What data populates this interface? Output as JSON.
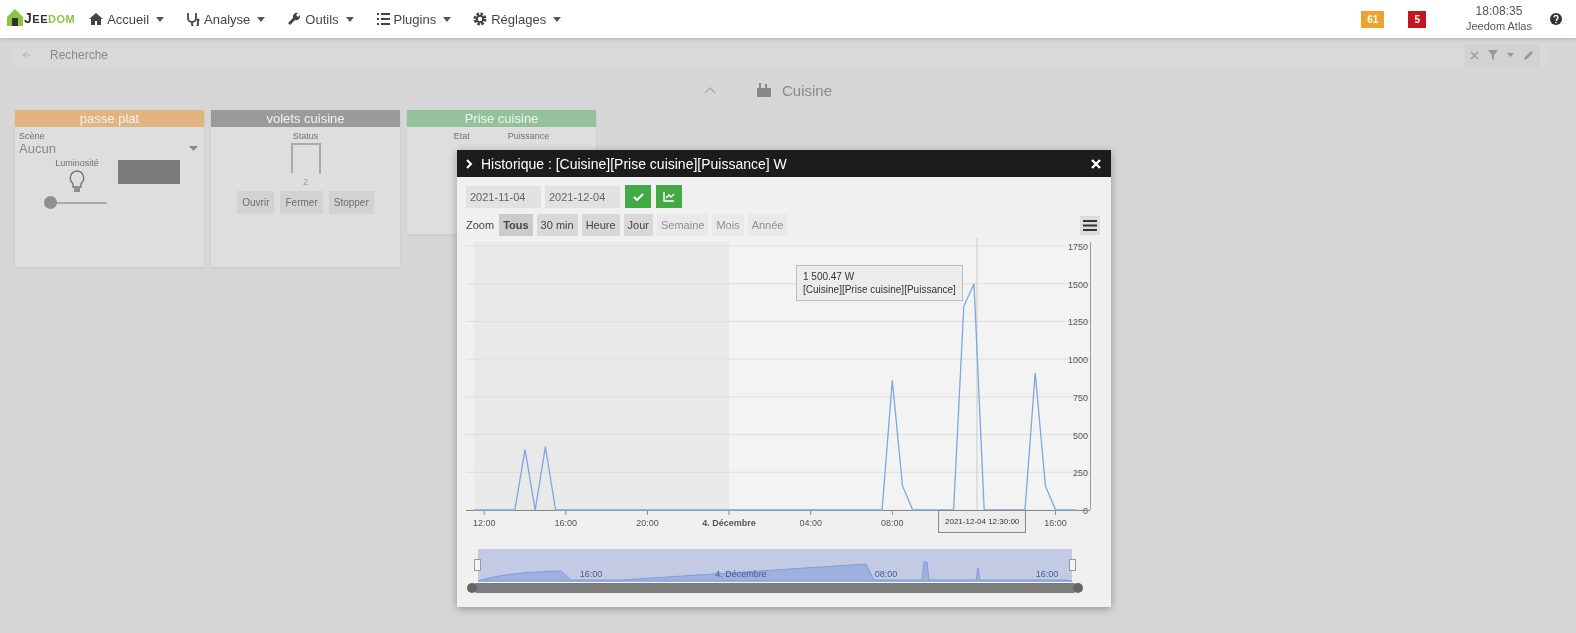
{
  "navbar": {
    "logo": {
      "initial": "J",
      "dark": "EE",
      "accent": "DOM"
    },
    "menu": [
      {
        "label": "Accueil"
      },
      {
        "label": "Analyse"
      },
      {
        "label": "Outils"
      },
      {
        "label": "Plugins"
      },
      {
        "label": "Réglages"
      }
    ],
    "badges": [
      {
        "text": "61",
        "color": "#f0a22e"
      },
      {
        "text": "5",
        "color": "#c4161c"
      }
    ],
    "time": "18:08:35",
    "user": "Jeedom Atlas"
  },
  "search": {
    "placeholder": "Recherche"
  },
  "room": {
    "title": "Cuisine"
  },
  "cards": [
    {
      "kind": "light",
      "title": "passe plat",
      "color": "#e2b47f",
      "scene_label": "Scène",
      "scene_value": "Aucun",
      "brightness_label": "Luminosité",
      "level": 0
    },
    {
      "kind": "shutter",
      "title": "volets cuisine",
      "color": "#9b9b9b",
      "status_label": "Status",
      "status_value": "2",
      "buttons": [
        "Ouvrir",
        "Fermer",
        "Stopper"
      ]
    },
    {
      "kind": "plug",
      "title": "Prise cuisine",
      "color": "#93c29a",
      "labels": [
        "Etat",
        "Puissance"
      ]
    }
  ],
  "modal": {
    "title": "Historique : [Cuisine][Prise cuisine][Puissance] W",
    "date_start": "2021-11-04",
    "date_end": "2021-12-04",
    "zoom_label": "Zoom",
    "zoom_buttons": [
      {
        "label": "Tous",
        "selected": true,
        "disabled": false
      },
      {
        "label": "30 min",
        "selected": false,
        "disabled": false
      },
      {
        "label": "Heure",
        "selected": false,
        "disabled": false
      },
      {
        "label": "Jour",
        "selected": false,
        "disabled": false
      },
      {
        "label": "Semaine",
        "selected": false,
        "disabled": true
      },
      {
        "label": "Mois",
        "selected": false,
        "disabled": true
      },
      {
        "label": "Année",
        "selected": false,
        "disabled": true
      }
    ],
    "chart_data": {
      "type": "line",
      "grid": true,
      "ylim": [
        0,
        1750
      ],
      "categories": [
        null,
        "12:00",
        null,
        null,
        null,
        null,
        null,
        null,
        null,
        "16:00",
        null,
        null,
        null,
        null,
        null,
        null,
        null,
        "20:00",
        null,
        null,
        null,
        null,
        null,
        null,
        null,
        "4. Décembre",
        null,
        null,
        null,
        null,
        null,
        null,
        null,
        "04:00",
        null,
        null,
        null,
        null,
        null,
        null,
        null,
        "08:00",
        null,
        null,
        null,
        null,
        null,
        null,
        null,
        null,
        null,
        null,
        null,
        null,
        null,
        null,
        null,
        "16:00",
        null,
        null
      ],
      "series": [
        {
          "color": "#7ca7e0",
          "values": [
            0,
            0,
            0,
            0,
            0,
            400,
            0,
            420,
            0,
            0,
            0,
            0,
            0,
            0,
            0,
            0,
            0,
            0,
            0,
            0,
            0,
            0,
            0,
            0,
            0,
            0,
            0,
            0,
            0,
            0,
            0,
            0,
            0,
            0,
            0,
            0,
            0,
            0,
            0,
            0,
            0,
            860,
            160,
            0,
            0,
            0,
            0,
            0,
            1350,
            1500,
            0,
            0,
            0,
            0,
            0,
            910,
            160,
            0,
            0,
            0
          ]
        }
      ],
      "yticks": [
        0,
        250,
        500,
        750,
        1000,
        1250,
        1500,
        1750
      ]
    },
    "tooltip": {
      "value": "1 500.47 W",
      "series": "[Cuisine][Prise cuisine][Puissance]"
    },
    "crosshair_label": "2021-12-04 12:30:00",
    "navigator_labels": [
      "16:00",
      "4. Décembre",
      "08:00",
      "16:00"
    ]
  }
}
